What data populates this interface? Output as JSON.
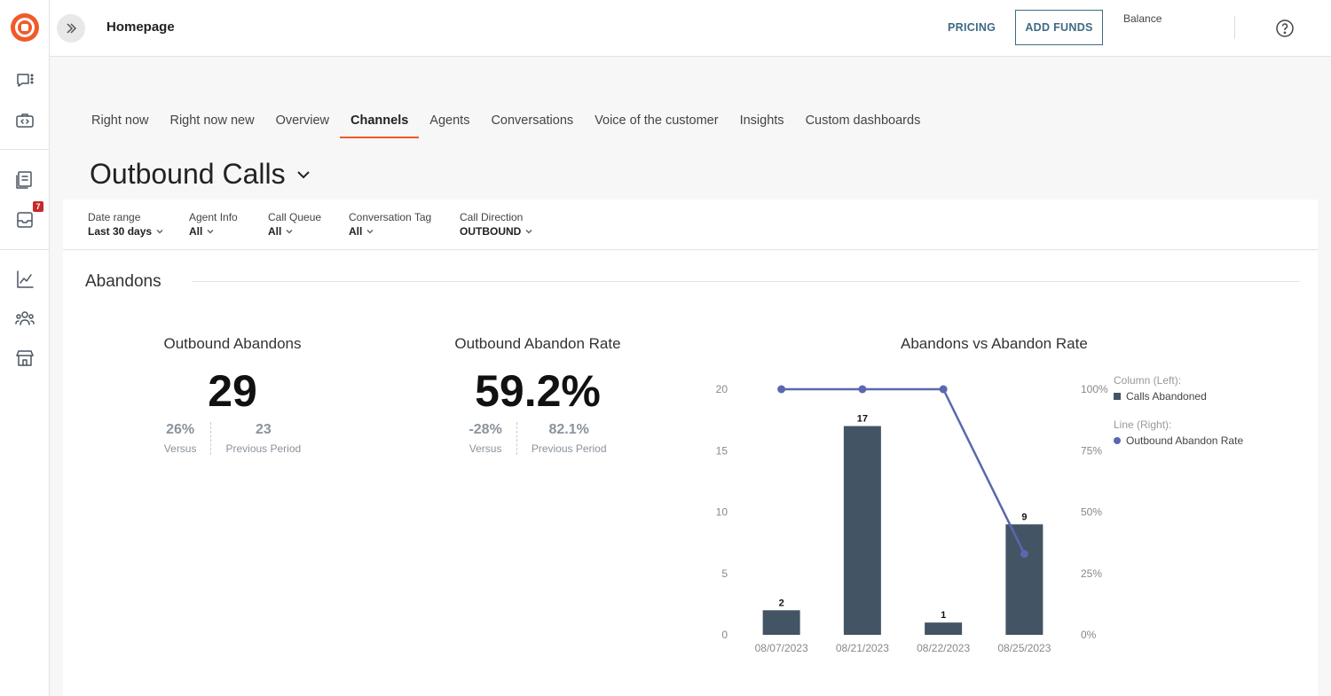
{
  "header": {
    "page_name": "Homepage",
    "pricing": "PRICING",
    "add_funds": "ADD FUNDS",
    "balance": "Balance"
  },
  "sidebar": {
    "badge_count": "7"
  },
  "tabs": [
    {
      "label": "Right now"
    },
    {
      "label": "Right now new"
    },
    {
      "label": "Overview"
    },
    {
      "label": "Channels",
      "active": true
    },
    {
      "label": "Agents"
    },
    {
      "label": "Conversations"
    },
    {
      "label": "Voice of the customer"
    },
    {
      "label": "Insights"
    },
    {
      "label": "Custom dashboards"
    }
  ],
  "dashboard_title": "Outbound Calls",
  "filters": [
    {
      "label": "Date range",
      "value": "Last 30 days"
    },
    {
      "label": "Agent Info",
      "value": "All"
    },
    {
      "label": "Call Queue",
      "value": "All"
    },
    {
      "label": "Conversation Tag",
      "value": "All"
    },
    {
      "label": "Call Direction",
      "value": "OUTBOUND"
    }
  ],
  "section": {
    "title": "Abandons"
  },
  "kpis": [
    {
      "title": "Outbound Abandons",
      "value": "29",
      "versus": "26%",
      "versus_label": "Versus",
      "previous": "23",
      "previous_label": "Previous Period"
    },
    {
      "title": "Outbound Abandon Rate",
      "value": "59.2%",
      "versus": "-28%",
      "versus_label": "Versus",
      "previous": "82.1%",
      "previous_label": "Previous Period"
    }
  ],
  "colors": {
    "accent": "#f05a28",
    "bar": "#435464",
    "line": "#5b67b0",
    "link": "#3d6a84"
  },
  "chart_data": {
    "type": "bar",
    "title": "Abandons vs Abandon Rate",
    "categories": [
      "08/07/2023",
      "08/21/2023",
      "08/22/2023",
      "08/25/2023"
    ],
    "series": [
      {
        "name": "Calls Abandoned",
        "type": "bar",
        "axis": "left",
        "values": [
          2,
          17,
          1,
          9
        ]
      },
      {
        "name": "Outbound Abandon Rate",
        "type": "line",
        "axis": "right",
        "values": [
          100,
          100,
          100,
          33
        ]
      }
    ],
    "ylim": [
      0,
      20
    ],
    "yticks": [
      "0",
      "5",
      "10",
      "15",
      "20"
    ],
    "y2lim": [
      0,
      100
    ],
    "y2ticks": [
      "0%",
      "25%",
      "50%",
      "75%",
      "100%"
    ],
    "legend": {
      "position": "right",
      "column_header": "Column (Left):",
      "line_header": "Line (Right):"
    },
    "grid": false
  }
}
